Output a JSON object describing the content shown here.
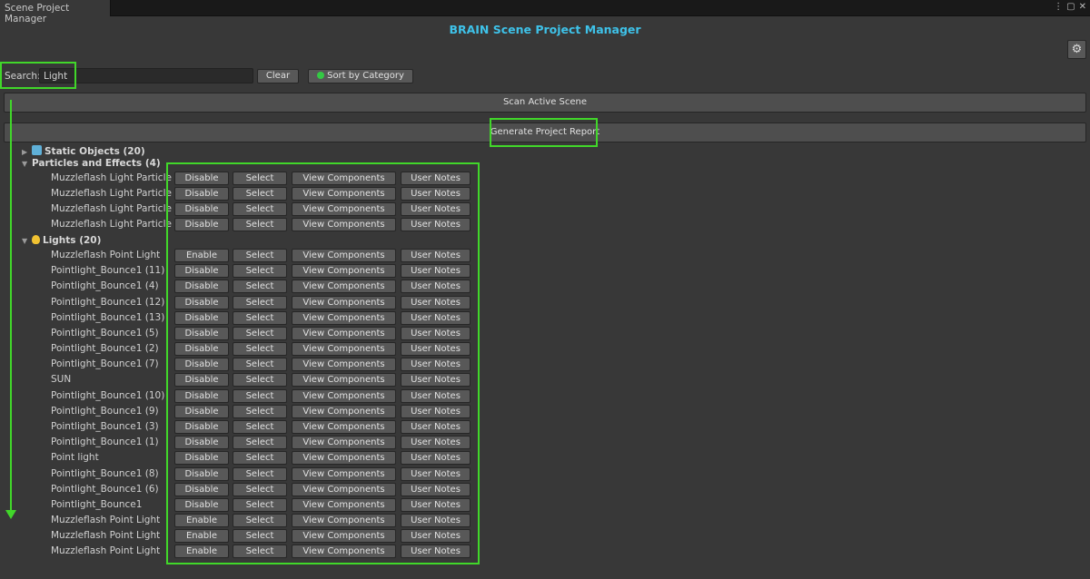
{
  "window": {
    "tab_title": "Scene Project Manager"
  },
  "header": {
    "title": "BRAIN Scene Project Manager"
  },
  "search": {
    "label": "Search:",
    "value": "Light"
  },
  "toolbar": {
    "clear_label": "Clear",
    "sort_label": "Sort by Category",
    "scan_label": "Scan Active Scene",
    "report_label": "Generate Project Report"
  },
  "groups": {
    "static": "Static Objects (20)",
    "particles": "Particles and Effects (4)",
    "lights": "Lights (20)"
  },
  "actions": {
    "select": "Select",
    "view": "View Components",
    "notes": "User Notes"
  },
  "particles": [
    {
      "name": "Muzzleflash Light Particle",
      "toggle": "Disable"
    },
    {
      "name": "Muzzleflash Light Particle",
      "toggle": "Disable"
    },
    {
      "name": "Muzzleflash Light Particle",
      "toggle": "Disable"
    },
    {
      "name": "Muzzleflash Light Particle",
      "toggle": "Disable"
    }
  ],
  "lights": [
    {
      "name": "Muzzleflash Point Light",
      "toggle": "Enable"
    },
    {
      "name": "Pointlight_Bounce1 (11)",
      "toggle": "Disable"
    },
    {
      "name": "Pointlight_Bounce1 (4)",
      "toggle": "Disable"
    },
    {
      "name": "Pointlight_Bounce1 (12)",
      "toggle": "Disable"
    },
    {
      "name": "Pointlight_Bounce1 (13)",
      "toggle": "Disable"
    },
    {
      "name": "Pointlight_Bounce1 (5)",
      "toggle": "Disable"
    },
    {
      "name": "Pointlight_Bounce1 (2)",
      "toggle": "Disable"
    },
    {
      "name": "Pointlight_Bounce1 (7)",
      "toggle": "Disable"
    },
    {
      "name": "SUN",
      "toggle": "Disable"
    },
    {
      "name": "Pointlight_Bounce1 (10)",
      "toggle": "Disable"
    },
    {
      "name": "Pointlight_Bounce1 (9)",
      "toggle": "Disable"
    },
    {
      "name": "Pointlight_Bounce1 (3)",
      "toggle": "Disable"
    },
    {
      "name": "Pointlight_Bounce1 (1)",
      "toggle": "Disable"
    },
    {
      "name": "Point light",
      "toggle": "Disable"
    },
    {
      "name": "Pointlight_Bounce1 (8)",
      "toggle": "Disable"
    },
    {
      "name": "Pointlight_Bounce1 (6)",
      "toggle": "Disable"
    },
    {
      "name": "Pointlight_Bounce1",
      "toggle": "Disable"
    },
    {
      "name": "Muzzleflash Point Light",
      "toggle": "Enable"
    },
    {
      "name": "Muzzleflash Point Light",
      "toggle": "Enable"
    },
    {
      "name": "Muzzleflash Point Light",
      "toggle": "Enable"
    }
  ],
  "colors": {
    "title": "#3ec2e9",
    "highlight": "#41d72a",
    "sort_dot": "#34c944"
  },
  "icons": {
    "settings": "gear-icon",
    "static_group": "cube-icon",
    "lights_group": "lightbulb-icon"
  }
}
